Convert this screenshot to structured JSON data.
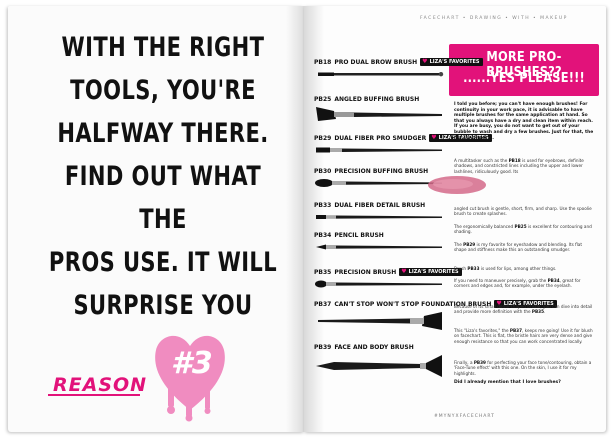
{
  "left_page": {
    "headline_lines": [
      "WITH THE RIGHT",
      "TOOLS, YOU'RE",
      "HALFWAY THERE.",
      "FIND OUT WHAT THE",
      "PROS USE. IT WILL",
      "SURPRISE YOU"
    ],
    "reason_label": "REASON",
    "reason_number": "#3"
  },
  "right_page": {
    "running_head": "FACECHART • DRAWING • WITH • MAKEUP",
    "title_line1": "MORE PRO-BRUSHES??",
    "title_line2": "......YES PLEASE!!!",
    "favorite_badge": "LIZA'S FAVORITES",
    "brushes": [
      {
        "code": "PB18",
        "name": "PRO DUAL BROW BRUSH",
        "favorite": true
      },
      {
        "code": "PB25",
        "name": "ANGLED BUFFING BRUSH",
        "favorite": false
      },
      {
        "code": "PB29",
        "name": "DUAL FIBER PRO SMUDGER",
        "favorite": true
      },
      {
        "code": "PB30",
        "name": "PRECISION BUFFING BRUSH",
        "favorite": false
      },
      {
        "code": "PB33",
        "name": "DUAL FIBER DETAIL BRUSH",
        "favorite": false
      },
      {
        "code": "PB34",
        "name": "PENCIL BRUSH",
        "favorite": false
      },
      {
        "code": "PB35",
        "name": "PRECISION BRUSH",
        "favorite": true
      },
      {
        "code": "PB37",
        "name": "CAN'T STOP WON'T STOP FOUNDATION BRUSH",
        "favorite": true
      },
      {
        "code": "PB39",
        "name": "FACE AND BODY BRUSH",
        "favorite": false
      }
    ],
    "intro_text": "I told you before; you can't have enough brushes! For continuity in your work pace, it is advisable to have multiple brushes for the same application at hand. So that you always have a dry and clean item within reach. If you are busy, you do not want to get out of your bubble to wash and dry a few brushes. Just for that, the list continues ...",
    "paragraphs": [
      "A multitasker such as the PB18 is used for eyebrows, definite shadows, and constricted lines including the upper and lower lashlines, ridiculously good. Its",
      "angled cut brush is gentle, short, firm, and sharp. Use the spoolie brush to create splashes.",
      "The ergonomically balanced PB25 is excellent for contouring and shading.",
      "The PB29 is my favorite for eyeshadow and blending. Its flat shape and stiffness make this an outstanding smudger.",
      "Brush PB33 is used for lips, among other things.",
      "If you need to maneuver precisely, grab the PB34, great for corners and edges and, for example, under the eyelash.",
      "Because of its small dome-shaped bristle, you can dive into detail and provide more definition with the PB35.",
      "This \"Liza's favorites,\" the PB37, keeps me going! Use it for blush on facechart. This is flat, the bristle hairs are very dense and give enough resistance so that you can work concentrated locally.",
      "Finally, a PB39 for perfecting your face tone/contouring, obtain a 'Face-Tune effect' with this one. On the skin, I use it for my highlights."
    ],
    "closing_question": "Did I already mention that I love brushes?",
    "footer_tag": "#MYNYXFACECHART"
  },
  "colors": {
    "accent": "#e2127a",
    "text": "#111111"
  }
}
